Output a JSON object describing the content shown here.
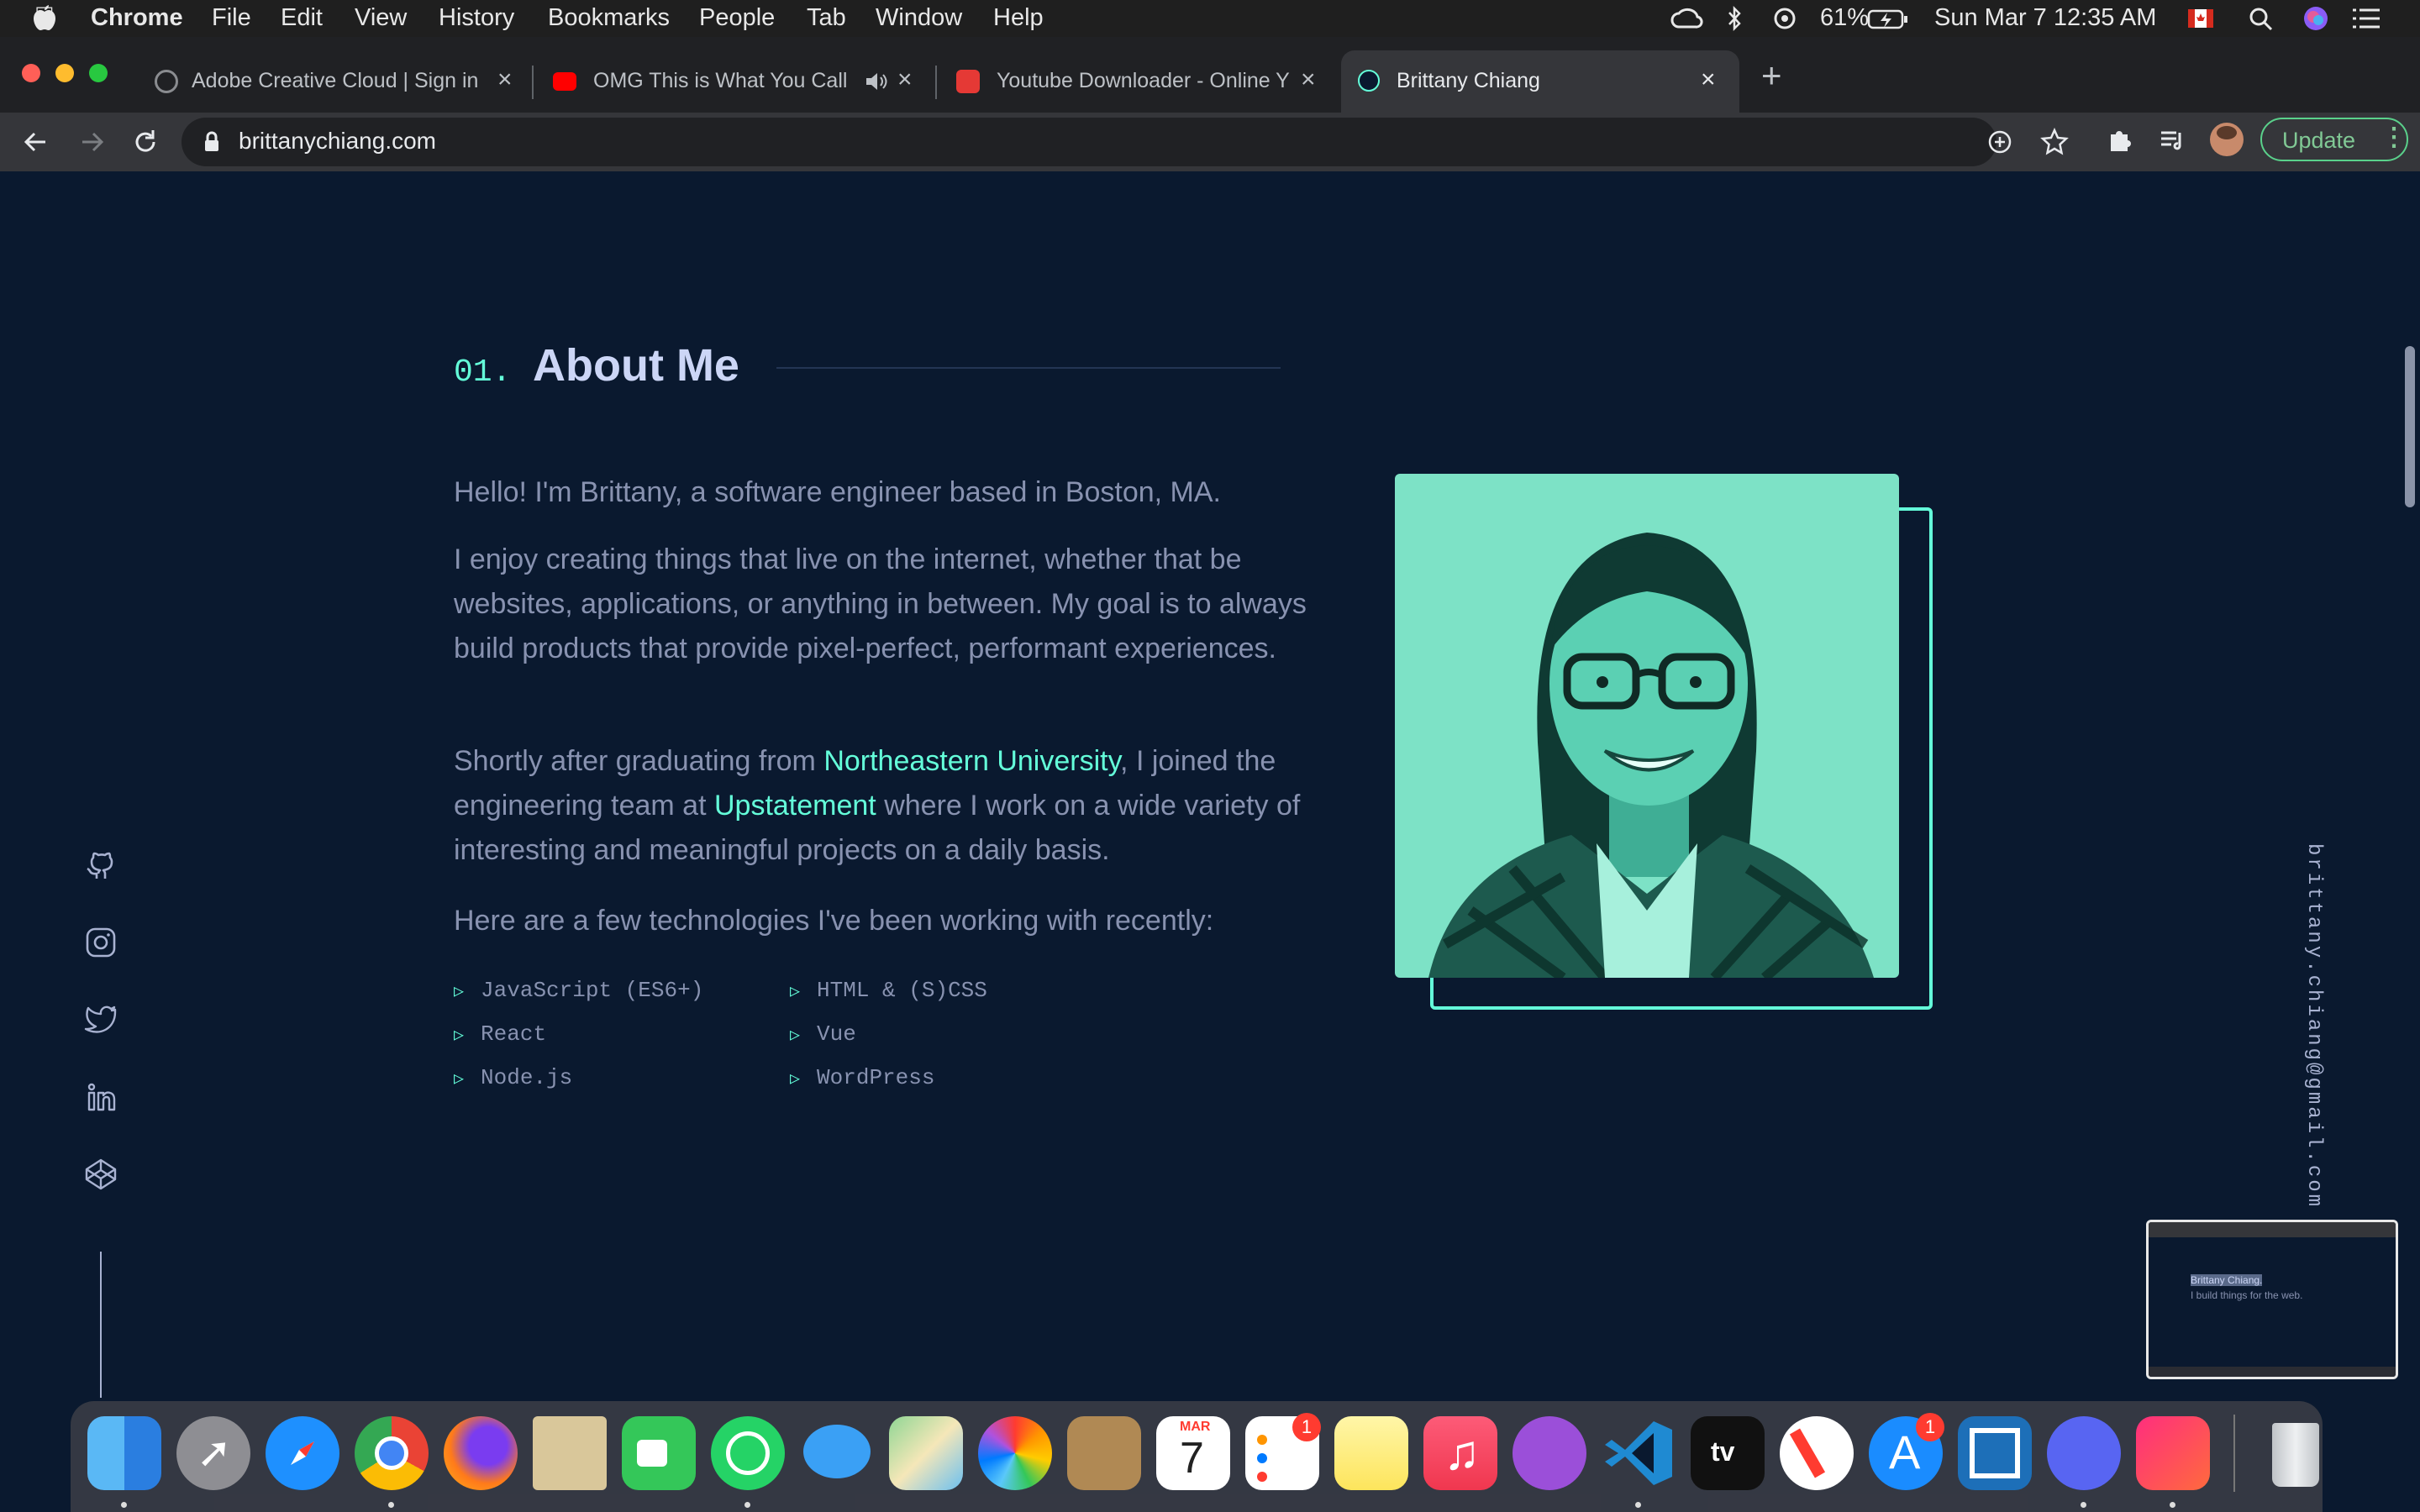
{
  "menubar": {
    "app": "Chrome",
    "items": [
      "File",
      "Edit",
      "View",
      "History",
      "Bookmarks",
      "People",
      "Tab",
      "Window",
      "Help"
    ],
    "battery": "61%",
    "datetime": "Sun Mar 7  12:35 AM"
  },
  "tabs": [
    {
      "title": "Adobe Creative Cloud | Sign in"
    },
    {
      "title": "OMG This is What You Call"
    },
    {
      "title": "Youtube Downloader - Online Y"
    },
    {
      "title": "Brittany Chiang"
    }
  ],
  "toolbar": {
    "url": "brittanychiang.com",
    "update_label": "Update"
  },
  "about": {
    "number": "01.",
    "heading": "About Me",
    "p1": "Hello! I'm Brittany, a software engineer based in Boston, MA.",
    "p2": "I enjoy creating things that live on the internet, whether that be websites, applications, or anything in between. My goal is to always build products that provide pixel-perfect, performant experiences.",
    "p3_a": "Shortly after graduating from ",
    "p3_link1": "Northeastern University",
    "p3_b": ", I joined the engineering team at ",
    "p3_link2": "Upstatement",
    "p3_c": " where I work on a wide variety of interesting and meaningful projects on a daily basis.",
    "p4": "Here are a few technologies I've been working with recently:",
    "tech_col1": [
      "JavaScript (ES6+)",
      "React",
      "Node.js"
    ],
    "tech_col2": [
      "HTML & (S)CSS",
      "Vue",
      "WordPress"
    ]
  },
  "side_email": "brittany.chiang@gmail.com",
  "thumbnail": {
    "name_line": "Brittany Chiang.",
    "tagline": "I build things for the web."
  },
  "dock": {
    "calendar_month": "MAR",
    "calendar_day": "7",
    "reminders_badge": "1",
    "appstore_badge": "1",
    "tv_label": "tv"
  },
  "colors": {
    "navy": "#0a192f",
    "accent_green": "#64ffda",
    "slate": "#8892b0",
    "light_slate": "#ccd6f6"
  }
}
